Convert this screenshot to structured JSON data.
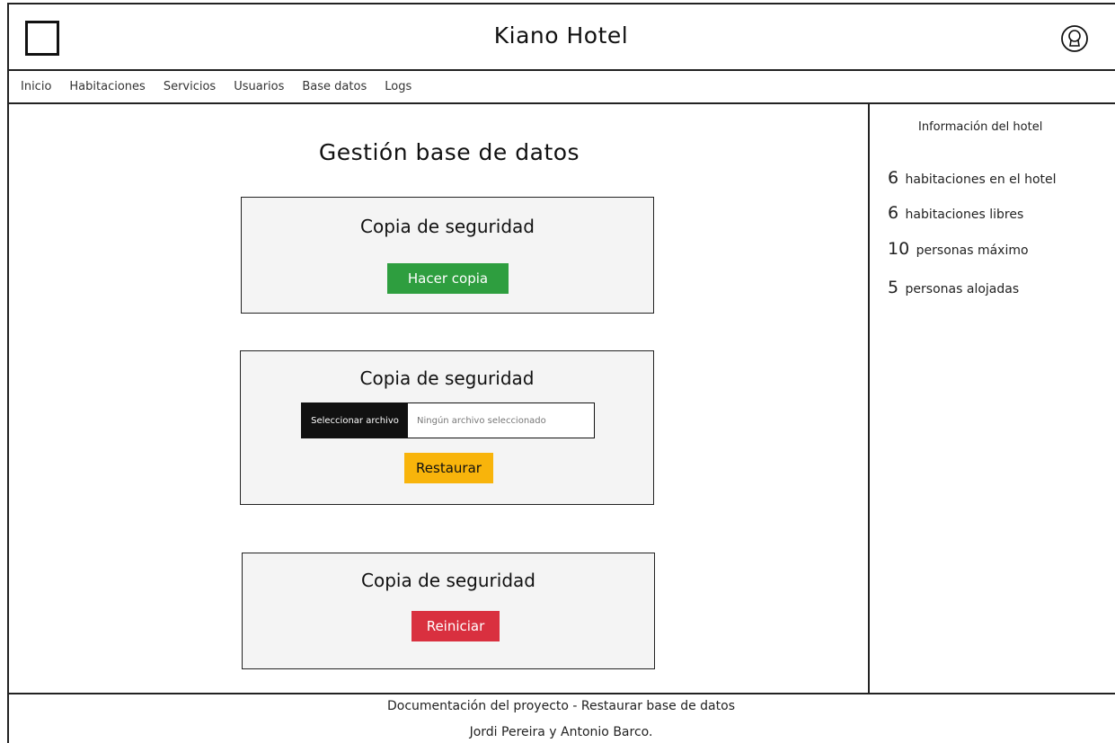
{
  "header": {
    "title": "Kiano Hotel",
    "logo_icon": "square-logo-icon",
    "user_icon": "user-avatar-icon"
  },
  "nav": {
    "items": [
      "Inicio",
      "Habitaciones",
      "Servicios",
      "Usuarios",
      "Base datos",
      "Logs"
    ]
  },
  "main": {
    "title": "Gestión base de datos",
    "backup_card": {
      "title": "Copia de seguridad",
      "button_label": "Hacer copia"
    },
    "restore_card": {
      "title": "Copia de seguridad",
      "file_button_label": "Seleccionar archivo",
      "file_status": "Ningún archivo seleccionado",
      "button_label": "Restaurar"
    },
    "reset_card": {
      "title": "Copia de seguridad",
      "button_label": "Reiniciar"
    }
  },
  "sidebar": {
    "title": "Información del hotel",
    "stats": [
      {
        "value": "6",
        "label": "habitaciones en el hotel"
      },
      {
        "value": "6",
        "label": "habitaciones libres"
      },
      {
        "value": "10",
        "label": "personas máximo"
      },
      {
        "value": "5",
        "label": "personas alojadas"
      }
    ]
  },
  "footer": {
    "line1": "Documentación del proyecto - Restaurar base de datos",
    "line2": "Jordi Pereira y Antonio Barco."
  },
  "colors": {
    "backup_button": "#2e9e3f",
    "restore_button": "#f8b40b",
    "reset_button": "#d9303f",
    "card_background": "#f4f4f4"
  }
}
